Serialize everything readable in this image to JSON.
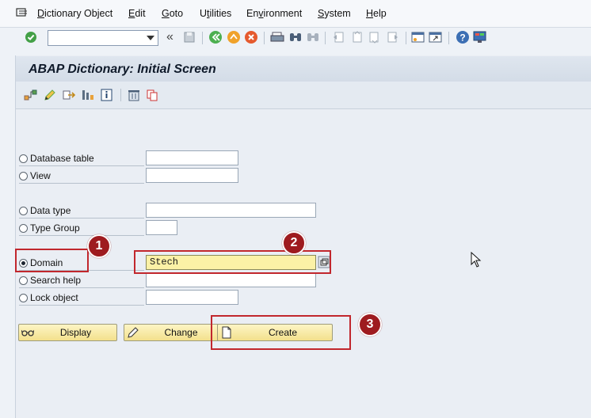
{
  "menu": {
    "items": [
      "Dictionary Object",
      "Edit",
      "Goto",
      "Utilities",
      "Environment",
      "System",
      "Help"
    ],
    "underline_chars": [
      "D",
      "E",
      "G",
      "t",
      "v",
      "S",
      "H"
    ]
  },
  "toolbar": {
    "back_glyph": "«",
    "command_value": ""
  },
  "screen": {
    "title": "ABAP Dictionary: Initial Screen"
  },
  "form": {
    "options": [
      {
        "label": "Database table",
        "value": "",
        "selected": false
      },
      {
        "label": "View",
        "value": "",
        "selected": false
      },
      {
        "label": "Data type",
        "value": "",
        "selected": false
      },
      {
        "label": "Type Group",
        "value": "",
        "selected": false
      },
      {
        "label": "Domain",
        "value": "Stech",
        "selected": true
      },
      {
        "label": "Search help",
        "value": "",
        "selected": false
      },
      {
        "label": "Lock object",
        "value": "",
        "selected": false
      }
    ]
  },
  "buttons": {
    "display": "Display",
    "change": "Change",
    "create": "Create"
  },
  "callouts": [
    "1",
    "2",
    "3"
  ],
  "colors": {
    "accent": "#c1272d",
    "badge": "#9e1b1f",
    "field_active": "#fbf1a6",
    "button": "#f3e08c"
  },
  "icons": [
    "check-icon",
    "save-icon",
    "back-icon",
    "exit-icon",
    "cancel-icon",
    "print-icon",
    "find-icon",
    "find-next-icon",
    "first-page-icon",
    "prev-page-icon",
    "next-page-icon",
    "last-page-icon",
    "new-session-icon",
    "shortcut-icon",
    "help-icon",
    "customize-icon",
    "hierarchy-icon",
    "edit-icon",
    "other-object-icon",
    "where-used-icon",
    "info-icon",
    "delete-icon",
    "copy-icon",
    "glasses-icon",
    "pencil-icon",
    "document-icon",
    "f4-help-icon",
    "menu-icon"
  ]
}
